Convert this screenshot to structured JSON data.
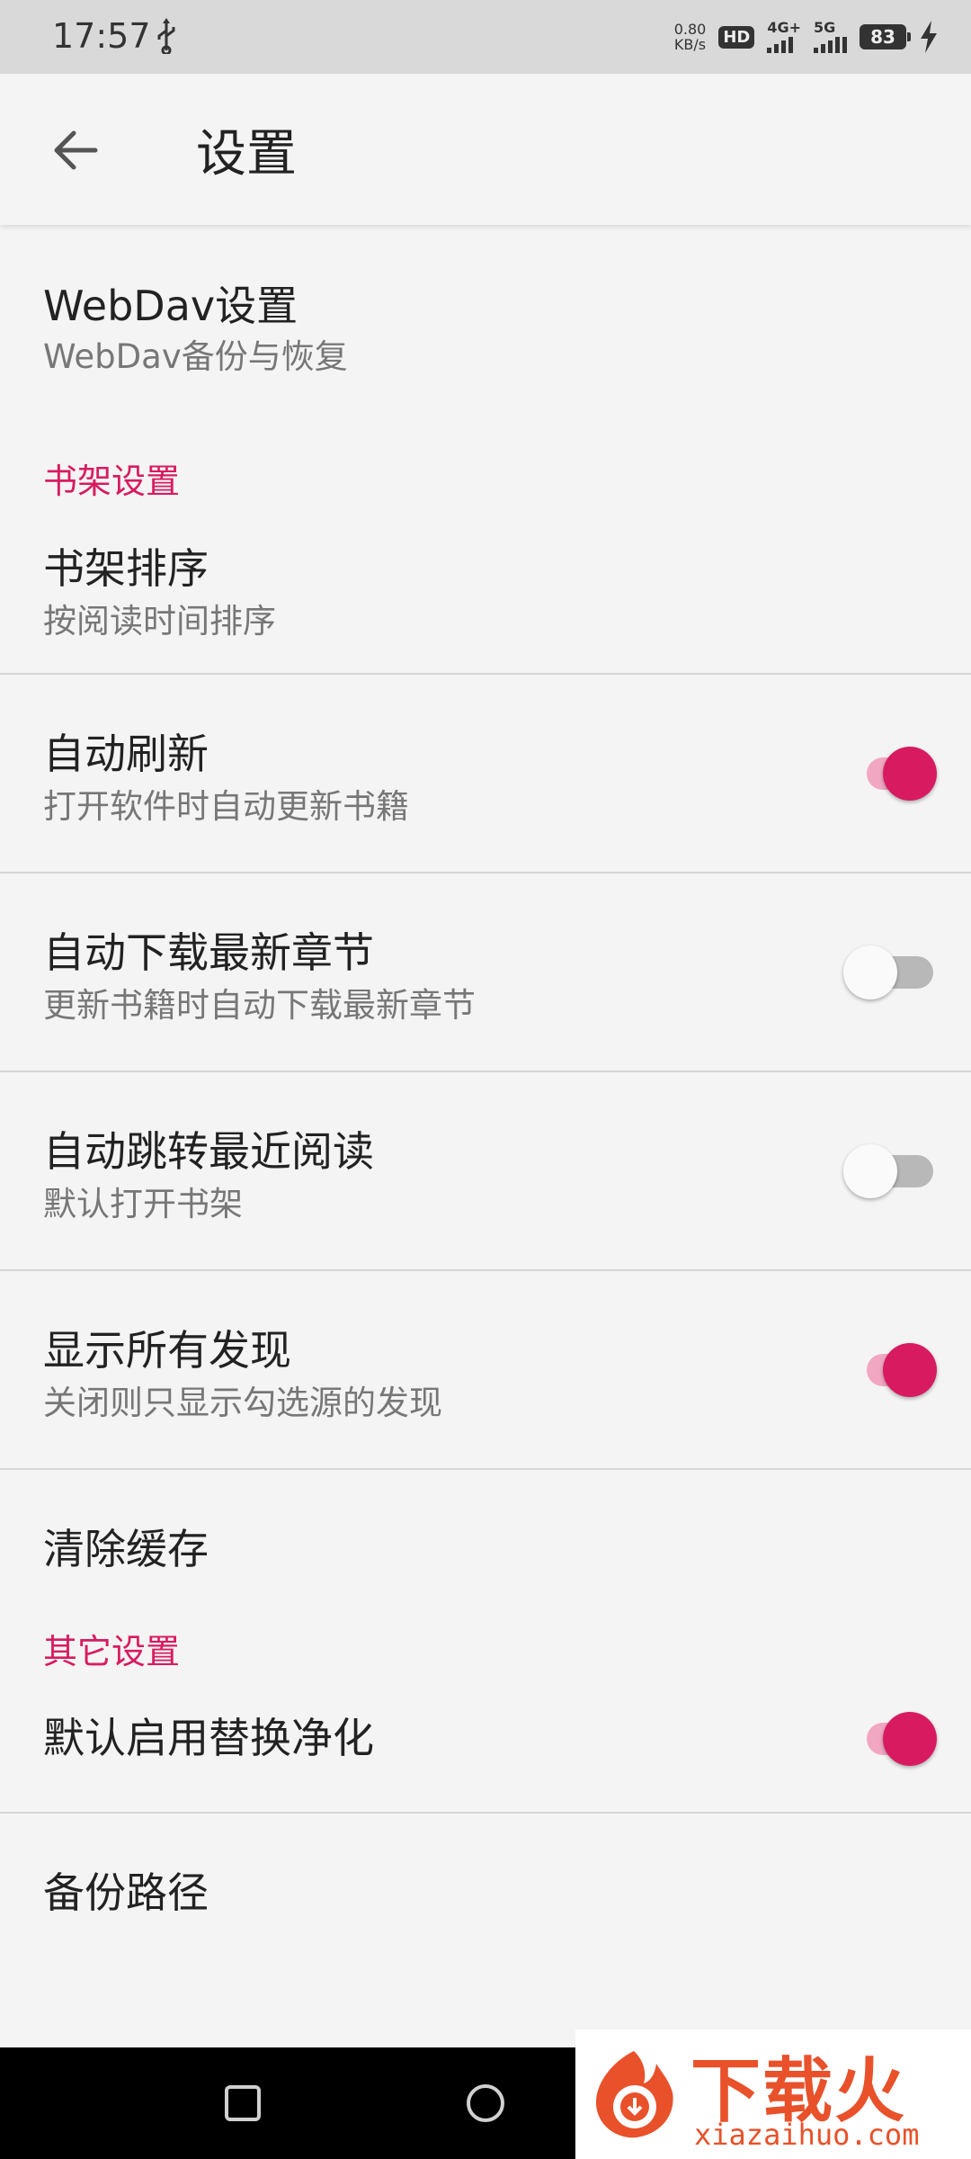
{
  "status_bar": {
    "time": "17:57",
    "net_speed": "0.80",
    "net_unit": "KB/s",
    "hd": "HD",
    "sig1_label": "4G+",
    "sig2_label": "5G",
    "battery": "83",
    "icons": [
      "usb-icon",
      "hd-icon",
      "signal-icon",
      "battery-icon",
      "charging-icon"
    ]
  },
  "app_bar": {
    "title": "设置",
    "back_icon": "arrow-back-icon"
  },
  "webdav": {
    "title": "WebDav设置",
    "subtitle": "WebDav备份与恢复"
  },
  "sections": {
    "bookshelf": "书架设置",
    "other": "其它设置"
  },
  "items": {
    "sort": {
      "title": "书架排序",
      "subtitle": "按阅读时间排序"
    },
    "auto_refresh": {
      "title": "自动刷新",
      "subtitle": "打开软件时自动更新书籍",
      "enabled": true
    },
    "auto_download": {
      "title": "自动下载最新章节",
      "subtitle": "更新书籍时自动下载最新章节",
      "enabled": false
    },
    "auto_jump": {
      "title": "自动跳转最近阅读",
      "subtitle": "默认打开书架",
      "enabled": false
    },
    "show_all": {
      "title": "显示所有发现",
      "subtitle": "关闭则只显示勾选源的发现",
      "enabled": true
    },
    "clear_cache": {
      "title": "清除缓存"
    },
    "replace_purify": {
      "title": "默认启用替换净化",
      "enabled": true
    },
    "backup_path": {
      "title": "备份路径"
    }
  },
  "watermark": {
    "text": "下载火",
    "url": "xiazaihuo.com"
  },
  "colors": {
    "accent": "#d81b60",
    "accent_track": "#f1a7c2",
    "off_track": "#b8b8b8",
    "background": "#f4f4f4",
    "status_bar": "#d9d9d9"
  }
}
